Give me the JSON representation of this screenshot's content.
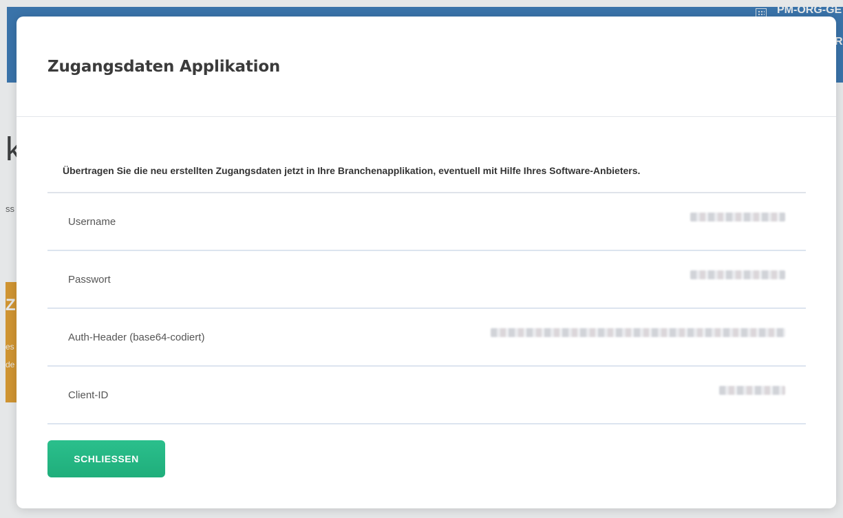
{
  "background": {
    "org_label": "PM-ORG-GE",
    "band_right_text": "R",
    "big_letter": "k",
    "small_text": "ss",
    "orange_card_title": "Z.",
    "orange_card_lines": [
      "es",
      "de"
    ],
    "band_color": "#2f72b3",
    "card_color": "#e59a22"
  },
  "modal": {
    "title": "Zugangsdaten Applikation",
    "intro": "Übertragen Sie die neu erstellten Zugangsdaten jetzt in Ihre Branchenapplikation, eventuell mit Hilfe Ihres Software-Anbieters.",
    "rows": [
      {
        "label": "Username",
        "value_state": "blurred"
      },
      {
        "label": "Passwort",
        "value_state": "blurred"
      },
      {
        "label": "Auth-Header (base64-codiert)",
        "value_state": "blurred"
      },
      {
        "label": "Client-ID",
        "value_state": "blurred"
      }
    ],
    "close_label": "SCHLIESSEN",
    "accent_color": "#1fae7b"
  }
}
